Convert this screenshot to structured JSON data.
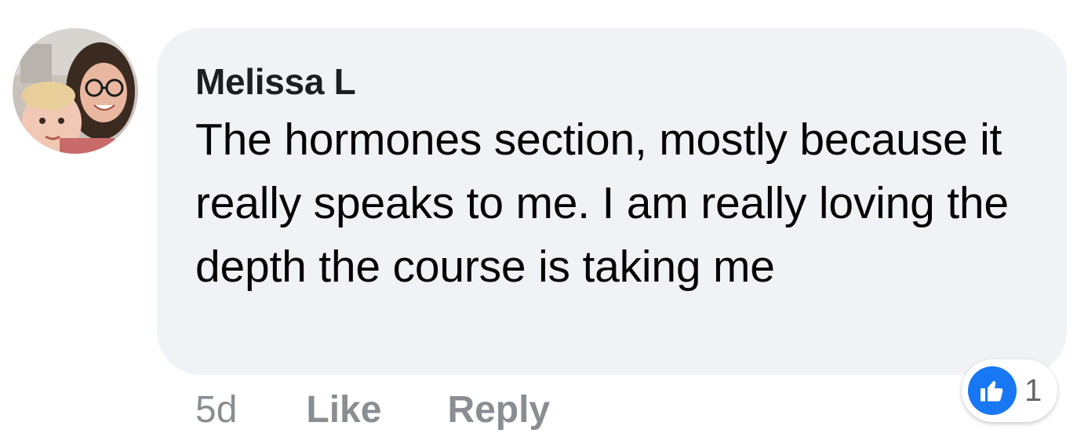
{
  "comment": {
    "author": "Melissa L",
    "text": "The hormones section, mostly because it really speaks to me. I am really loving the depth the course is taking me",
    "timestamp": "5d",
    "like_label": "Like",
    "reply_label": "Reply",
    "reaction_count": "1",
    "reaction_icon": "thumbs-up-icon",
    "avatar_icon": "profile-photo"
  },
  "colors": {
    "bubble": "#f0f2f5",
    "like_badge": "#1877f2",
    "action_text": "#8a8d91"
  }
}
